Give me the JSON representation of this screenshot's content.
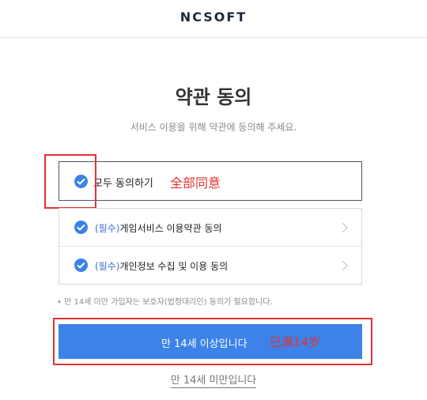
{
  "header": {
    "logo": "NCSOFT"
  },
  "main": {
    "title": "약관 동의",
    "subtitle": "서비스 이용을 위해 약관에 동의해 주세요."
  },
  "agree_all": {
    "label": "모두 동의하기",
    "checked": true
  },
  "terms": [
    {
      "required_tag": "(필수)",
      "label": "게임서비스 이용약관 동의",
      "checked": true
    },
    {
      "required_tag": "(필수)",
      "label": "개인정보 수집 및 이용 동의",
      "checked": true
    }
  ],
  "notice": "• 만 14세 미만 가입자는 보호자(법정대리인) 동의가 필요합니다.",
  "buttons": {
    "over_14": "만 14세 이상입니다",
    "under_14": "만 14세 미만입니다"
  },
  "annotations": {
    "agree_all_note": "全部同意",
    "over_14_note": "已满14岁"
  },
  "colors": {
    "accent": "#3c82e8",
    "annotation": "#e23232"
  },
  "icons": {
    "check": "check-circle-icon",
    "chevron": "chevron-right-icon"
  }
}
